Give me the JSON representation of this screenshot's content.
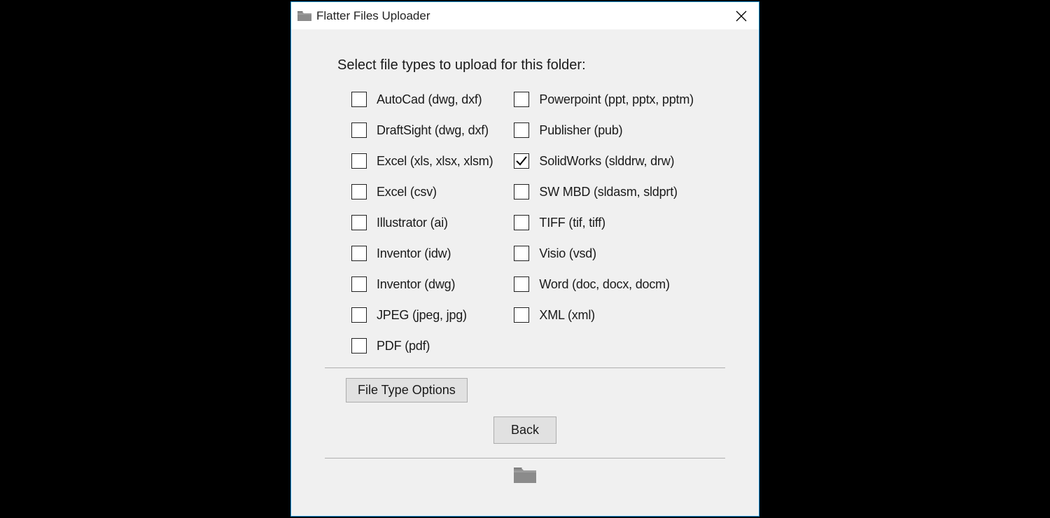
{
  "window": {
    "title": "Flatter Files Uploader"
  },
  "heading": "Select file types to upload for this folder:",
  "leftColumn": [
    {
      "label": "AutoCad (dwg, dxf)",
      "checked": false
    },
    {
      "label": "DraftSight (dwg, dxf)",
      "checked": false
    },
    {
      "label": "Excel (xls, xlsx, xlsm)",
      "checked": false
    },
    {
      "label": "Excel (csv)",
      "checked": false
    },
    {
      "label": "Illustrator (ai)",
      "checked": false
    },
    {
      "label": "Inventor (idw)",
      "checked": false
    },
    {
      "label": "Inventor (dwg)",
      "checked": false
    },
    {
      "label": "JPEG (jpeg, jpg)",
      "checked": false
    },
    {
      "label": "PDF (pdf)",
      "checked": false
    }
  ],
  "rightColumn": [
    {
      "label": "Powerpoint (ppt, pptx, pptm)",
      "checked": false
    },
    {
      "label": "Publisher (pub)",
      "checked": false
    },
    {
      "label": "SolidWorks (slddrw, drw)",
      "checked": true
    },
    {
      "label": "SW MBD (sldasm, sldprt)",
      "checked": false
    },
    {
      "label": "TIFF (tif, tiff)",
      "checked": false
    },
    {
      "label": "Visio (vsd)",
      "checked": false
    },
    {
      "label": "Word (doc, docx, docm)",
      "checked": false
    },
    {
      "label": "XML (xml)",
      "checked": false
    }
  ],
  "buttons": {
    "options": "File Type Options",
    "back": "Back"
  }
}
